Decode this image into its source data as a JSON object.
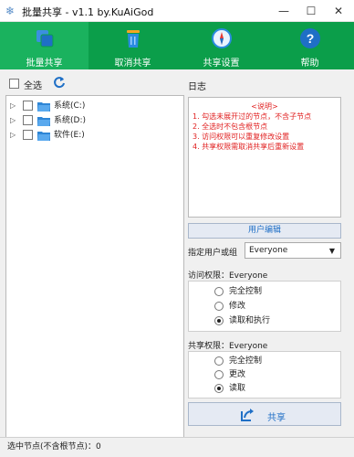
{
  "window": {
    "title": "批量共享 - v1.1 by.KuAiGod",
    "minimize_glyph": "—",
    "maximize_glyph": "☐",
    "close_glyph": "✕"
  },
  "toolbar": {
    "items": [
      {
        "label": "批量共享",
        "icon": "share-windows-icon",
        "active": true
      },
      {
        "label": "取消共享",
        "icon": "trash-can-icon",
        "active": false
      },
      {
        "label": "共享设置",
        "icon": "compass-icon",
        "active": false
      },
      {
        "label": "帮助",
        "icon": "help-icon",
        "active": false
      }
    ]
  },
  "left": {
    "select_all_label": "全选",
    "refresh_icon": "refresh-icon",
    "drives": [
      {
        "label": "系统(C:)",
        "checked": false
      },
      {
        "label": "系统(D:)",
        "checked": false
      },
      {
        "label": "软件(E:)",
        "checked": false
      }
    ]
  },
  "right": {
    "log_label": "日志",
    "log_lines": [
      "<说明>",
      "1. 勾选未展开过的节点，不含子节点",
      "2. 全选时不包含根节点",
      "3. 访问权限可以重复修改设置",
      "4. 共享权限需取消共享后重新设置"
    ],
    "user_edit_button": "用户编辑",
    "specify_user_label": "指定用户或组",
    "user_select_value": "Everyone",
    "access_label": "访问权限：Everyone",
    "access_options": [
      {
        "label": "完全控制",
        "selected": false
      },
      {
        "label": "修改",
        "selected": false
      },
      {
        "label": "读取和执行",
        "selected": true
      }
    ],
    "share_perm_label": "共享权限：Everyone",
    "share_options": [
      {
        "label": "完全控制",
        "selected": false
      },
      {
        "label": "更改",
        "selected": false
      },
      {
        "label": "读取",
        "selected": true
      }
    ],
    "share_button": "共享"
  },
  "status": {
    "text": "选中节点(不含根节点)：0"
  },
  "colors": {
    "toolbar_bg": "#0b9e4a",
    "toolbar_active": "#1ab25e",
    "log_text": "#e02020",
    "accent_blue": "#1f6fc6"
  }
}
